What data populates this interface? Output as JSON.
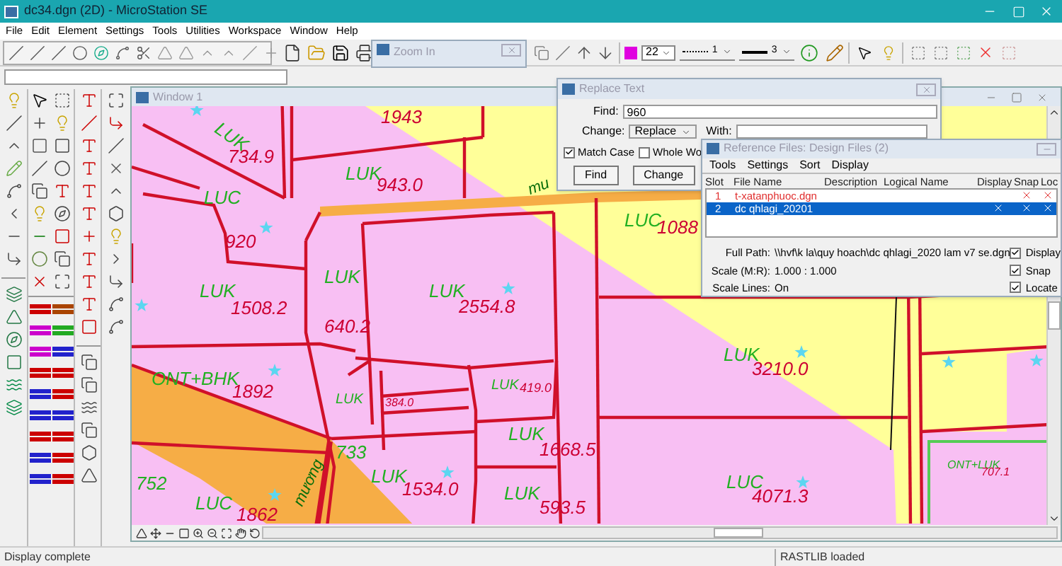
{
  "window": {
    "title": "dc34.dgn (2D) - MicroStation SE"
  },
  "menu": [
    "File",
    "Edit",
    "Element",
    "Settings",
    "Tools",
    "Utilities",
    "Workspace",
    "Window",
    "Help"
  ],
  "attributes": {
    "level": "22",
    "line_style": "1",
    "line_weight": "3"
  },
  "zoom_window": {
    "title": "Zoom In"
  },
  "view": {
    "title": "Window 1",
    "labels": [
      {
        "text": "1943",
        "kind": "area"
      },
      {
        "text": "LUK",
        "kind": "code"
      },
      {
        "text": "734.9",
        "kind": "area"
      },
      {
        "text": "LUK",
        "kind": "code"
      },
      {
        "text": "943.0",
        "kind": "area"
      },
      {
        "text": "LUC",
        "kind": "code"
      },
      {
        "text": "920",
        "kind": "area"
      },
      {
        "text": "LUK",
        "kind": "code"
      },
      {
        "text": "1508.2",
        "kind": "area"
      },
      {
        "text": "LUK",
        "kind": "code"
      },
      {
        "text": "640.2",
        "kind": "area"
      },
      {
        "text": "LUK",
        "kind": "code"
      },
      {
        "text": "2554.8",
        "kind": "area"
      },
      {
        "text": "ONT+BHK",
        "kind": "code"
      },
      {
        "text": "1892",
        "kind": "area"
      },
      {
        "text": "LUK",
        "kind": "code"
      },
      {
        "text": "384.0",
        "kind": "area"
      },
      {
        "text": "LUK",
        "kind": "code"
      },
      {
        "text": "419.0",
        "kind": "area"
      },
      {
        "text": "733",
        "kind": "code"
      },
      {
        "text": "LUK",
        "kind": "code"
      },
      {
        "text": "1534.0",
        "kind": "area"
      },
      {
        "text": "LUK",
        "kind": "code"
      },
      {
        "text": "1668.5",
        "kind": "area"
      },
      {
        "text": "LUK",
        "kind": "code"
      },
      {
        "text": "593.5",
        "kind": "area"
      },
      {
        "text": "752",
        "kind": "code"
      },
      {
        "text": "LUC",
        "kind": "code"
      },
      {
        "text": "1862",
        "kind": "area"
      },
      {
        "text": "mương",
        "kind": "river"
      },
      {
        "text": "mu",
        "kind": "river"
      },
      {
        "text": "LUC",
        "kind": "code"
      },
      {
        "text": "1088",
        "kind": "area"
      },
      {
        "text": "LUK",
        "kind": "code"
      },
      {
        "text": "3210.0",
        "kind": "area"
      },
      {
        "text": "LUC",
        "kind": "code"
      },
      {
        "text": "4071.3",
        "kind": "area"
      },
      {
        "text": "ONT+LUK",
        "kind": "code"
      },
      {
        "text": "707.1",
        "kind": "area"
      }
    ]
  },
  "replace_text": {
    "title": "Replace Text",
    "find_label": "Find:",
    "find_value": "960",
    "change_label": "Change:",
    "change_value": "Replace",
    "with_label": "With:",
    "options": [
      {
        "label": "Match Case",
        "checked": true
      },
      {
        "label": "Whole Wo",
        "checked": false
      }
    ],
    "buttons": [
      "Find",
      "Change"
    ]
  },
  "reference_files": {
    "title": "Reference Files: Design Files (2)",
    "menu": [
      "Tools",
      "Settings",
      "Sort",
      "Display"
    ],
    "columns": [
      "Slot",
      "File Name",
      "Description",
      "Logical Name",
      "Display",
      "Snap",
      "Loc"
    ],
    "rows": [
      {
        "slot": "1",
        "file": "t-xatanphuoc.dgn",
        "unresolved": true,
        "selected": false,
        "display": false,
        "snap": true,
        "locate": true
      },
      {
        "slot": "2",
        "file": "dc qhlagi_20201",
        "unresolved": false,
        "selected": true,
        "display": true,
        "snap": true,
        "locate": true
      }
    ],
    "full_path_label": "Full Path:",
    "full_path": "\\\\hvf\\k la\\quy hoach\\dc qhlagi_2020 lam v7 se.dgn",
    "scale_label": "Scale (M:R):",
    "scale": "1.000 : 1.000",
    "scale_lines_label": "Scale Lines:",
    "scale_lines": "On",
    "options": [
      {
        "label": "Display",
        "checked": true
      },
      {
        "label": "Snap",
        "checked": true
      },
      {
        "label": "Locate",
        "checked": true
      }
    ]
  },
  "status_bar": {
    "message": "Display complete",
    "module": "RASTLIB loaded"
  }
}
